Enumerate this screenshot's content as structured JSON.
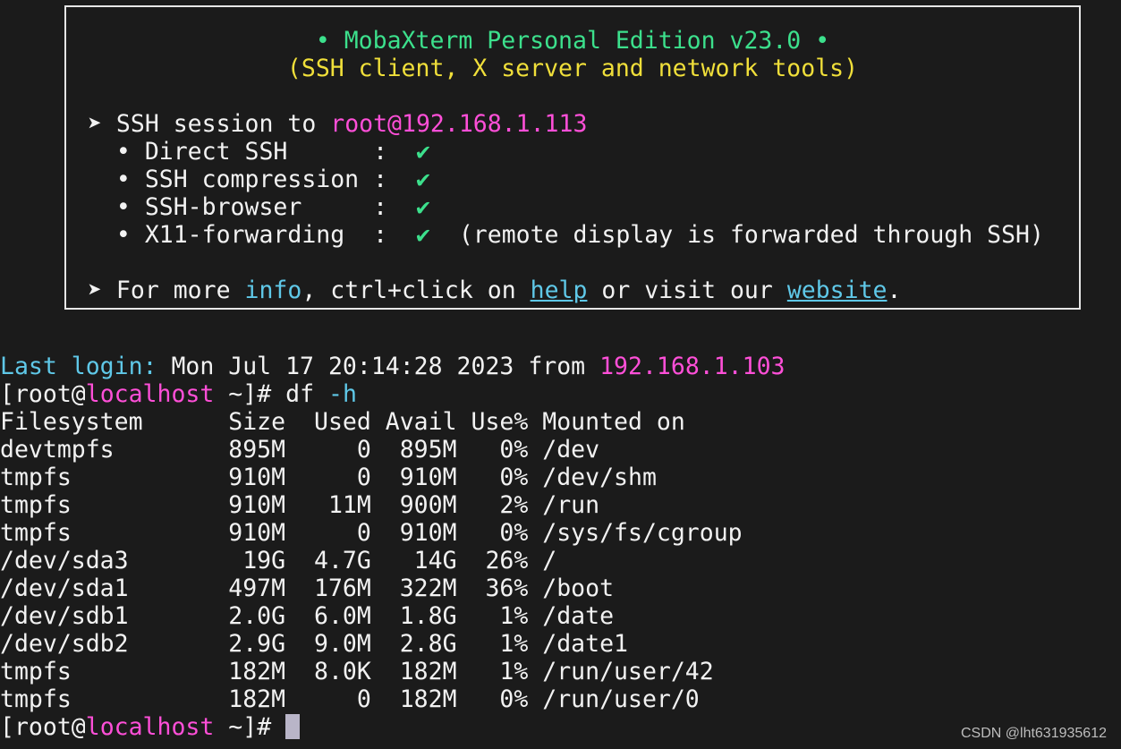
{
  "banner": {
    "title": "• MobaXterm Personal Edition v23.0 •",
    "subtitle": "(SSH client, X server and network tools)",
    "session_prefix": "➤ SSH session to ",
    "session_host": "root@192.168.1.113",
    "features": [
      {
        "label": "  • Direct SSH      :  ",
        "check": "✔",
        "note": ""
      },
      {
        "label": "  • SSH compression :  ",
        "check": "✔",
        "note": ""
      },
      {
        "label": "  • SSH-browser     :  ",
        "check": "✔",
        "note": ""
      },
      {
        "label": "  • X11-forwarding  :  ",
        "check": "✔",
        "note": "  (remote display is forwarded through SSH)"
      }
    ],
    "info_line": {
      "prefix": "➤ For more ",
      "info": "info",
      "middle": ", ctrl+click on ",
      "help": "help",
      "middle2": " or visit our ",
      "website": "website",
      "suffix": "."
    }
  },
  "terminal": {
    "last_login_label": "Last login:",
    "last_login_time": " Mon Jul 17 20:14:28 2023 from ",
    "last_login_ip": "192.168.1.103",
    "prompt_open": "[root@",
    "prompt_host": "localhost",
    "prompt_close": " ~]# ",
    "command": "df",
    "command_arg": " -h",
    "table_header": "Filesystem      Size  Used Avail Use% Mounted on",
    "table_rows": [
      "devtmpfs        895M     0  895M   0% /dev",
      "tmpfs           910M     0  910M   0% /dev/shm",
      "tmpfs           910M   11M  900M   2% /run",
      "tmpfs           910M     0  910M   0% /sys/fs/cgroup",
      "/dev/sda3        19G  4.7G   14G  26% /",
      "/dev/sda1       497M  176M  322M  36% /boot",
      "/dev/sdb1       2.0G  6.0M  1.8G   1% /date",
      "/dev/sdb2       2.9G  9.0M  2.8G   1% /date1",
      "tmpfs           182M  8.0K  182M   1% /run/user/42",
      "tmpfs           182M     0  182M   0% /run/user/0"
    ]
  },
  "watermark": "CSDN @lht631935612",
  "colors": {
    "background": "#1b1b1b",
    "green": "#3ce08c",
    "yellow": "#f0df3a",
    "magenta": "#ff4fd8",
    "cyan": "#5fc8e8",
    "cursor": "#b9b5c8"
  }
}
